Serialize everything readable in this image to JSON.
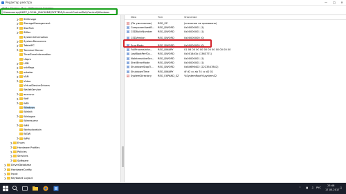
{
  "window": {
    "title": "Редактор реестра"
  },
  "menu": [
    "Файл",
    "Правка",
    "Вид",
    "Избранное",
    "Справка"
  ],
  "address": {
    "value": "Компьютер\\HKEY_LOCAL_MACHINE\\SYSTEM\\CurrentControlSet\\Control\\Windows"
  },
  "tree": [
    {
      "label": "StillImage",
      "indent": 1,
      "expandable": true
    },
    {
      "label": "StorageManagement",
      "indent": 1,
      "expandable": true
    },
    {
      "label": "StorPort",
      "indent": 1,
      "expandable": true
    },
    {
      "label": "StSec",
      "indent": 1,
      "expandable": true
    },
    {
      "label": "SystemInformation",
      "indent": 1,
      "expandable": false
    },
    {
      "label": "SystemResources",
      "indent": 1,
      "expandable": true
    },
    {
      "label": "TabletPC",
      "indent": 1,
      "expandable": true
    },
    {
      "label": "Terminal Server",
      "indent": 1,
      "expandable": true
    },
    {
      "label": "TimeZoneInformation",
      "indent": 1,
      "expandable": false
    },
    {
      "label": "Ubpm",
      "indent": 1,
      "expandable": false
    },
    {
      "label": "USB",
      "indent": 1,
      "expandable": true
    },
    {
      "label": "usbflags",
      "indent": 1,
      "expandable": true
    },
    {
      "label": "usbstor",
      "indent": 1,
      "expandable": true
    },
    {
      "label": "VAN",
      "indent": 1,
      "expandable": true
    },
    {
      "label": "Video",
      "indent": 1,
      "expandable": true
    },
    {
      "label": "VirtualDeviceDrivers",
      "indent": 1,
      "expandable": false
    },
    {
      "label": "WalletService",
      "indent": 1,
      "expandable": false
    },
    {
      "label": "wcncsvc",
      "indent": 1,
      "expandable": true
    },
    {
      "label": "Wdf",
      "indent": 1,
      "expandable": true
    },
    {
      "label": "WDI",
      "indent": 1,
      "expandable": true
    },
    {
      "label": "Windows",
      "indent": 1,
      "expandable": false,
      "selected": true
    },
    {
      "label": "WinInit",
      "indent": 1,
      "expandable": false
    },
    {
      "label": "Winlogon",
      "indent": 1,
      "expandable": true
    },
    {
      "label": "Winresume",
      "indent": 1,
      "expandable": false
    },
    {
      "label": "WMI",
      "indent": 1,
      "expandable": true
    },
    {
      "label": "WorkplaceJoin",
      "indent": 1,
      "expandable": false
    },
    {
      "label": "WOW",
      "indent": 1,
      "expandable": false
    },
    {
      "label": "WPN",
      "indent": 1,
      "expandable": true
    },
    {
      "label": "Enum",
      "indent": 0,
      "expandable": true
    },
    {
      "label": "Hardware Profiles",
      "indent": 0,
      "expandable": true
    },
    {
      "label": "Policies",
      "indent": 0,
      "expandable": true
    },
    {
      "label": "Services",
      "indent": 0,
      "expandable": true
    },
    {
      "label": "Software",
      "indent": 0,
      "expandable": true
    },
    {
      "label": "DriverDatabase",
      "indent": -1,
      "expandable": true
    },
    {
      "label": "HardwareConfig",
      "indent": -1,
      "expandable": true
    },
    {
      "label": "Input",
      "indent": -1,
      "expandable": true
    },
    {
      "label": "Keyboard Layout",
      "indent": -1,
      "expandable": true
    }
  ],
  "values": {
    "headers": {
      "name": "Имя",
      "type": "Тип",
      "data": "Значение"
    },
    "rows": [
      {
        "icon": "string-value-icon",
        "name": "(По умолчанию)",
        "type": "REG_SZ",
        "data": "(значение не присвоено)"
      },
      {
        "icon": "binary-value-icon",
        "name": "ComponentizedB...",
        "type": "REG_DWORD",
        "data": "0x00000001 (1)"
      },
      {
        "icon": "binary-value-icon",
        "name": "CSDBuildNumber",
        "type": "REG_DWORD",
        "data": "0x00000001 (1)"
      },
      {
        "icon": "binary-value-icon",
        "name": "CSDVersion",
        "type": "REG_DWORD",
        "data": "0x00000000 (0)",
        "highlighted": true
      },
      {
        "icon": "binary-value-icon",
        "name": "ErrorMode",
        "type": "REG_DWORD",
        "data": "0x00000000 (0)"
      },
      {
        "icon": "binary-value-icon",
        "name": "FullProcessInfor...",
        "type": "REG_BINARY",
        "data": "01 06 00 00 00 00 00 00 00 00 00 00"
      },
      {
        "icon": "binary-value-icon",
        "name": "LastBootPerfCo...",
        "type": "REG_DWORD",
        "data": "0x0014d1b (1363771)"
      },
      {
        "icon": "binary-value-icon",
        "name": "NoInteractiveSer...",
        "type": "REG_DWORD",
        "data": "0x00000001 (1)"
      },
      {
        "icon": "binary-value-icon",
        "name": "ShellErrorMode",
        "type": "REG_DWORD",
        "data": "0x00000001 (1)"
      },
      {
        "icon": "binary-value-icon",
        "name": "ShutdownStopTi...",
        "type": "REG_DWORD",
        "data": "0x84696402 (2223547842)"
      },
      {
        "icon": "binary-value-icon",
        "name": "ShutdownTime",
        "type": "REG_BINARY",
        "data": "4f d2 cc ab 74 cc d2 01"
      },
      {
        "icon": "string-value-icon",
        "name": "SystemDirectory",
        "type": "REG_EXPAND_SZ",
        "data": "%SystemRoot%\\system32"
      }
    ]
  },
  "taskbar": {
    "time": "23:48",
    "date": "17.05.2017",
    "lang": "РУС"
  },
  "colors": {
    "address_highlight": "#16a01a",
    "value_highlight": "#d3222a",
    "taskbar": "#1b1f2a",
    "folder": "#f5c63c"
  }
}
